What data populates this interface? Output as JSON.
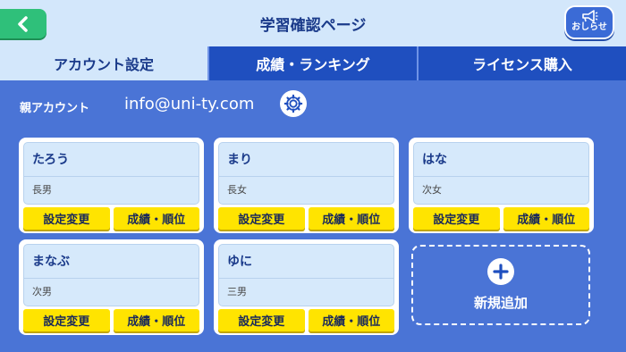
{
  "header": {
    "title": "学習確認ページ",
    "back_icon": "chevron-left-icon",
    "notice_label": "おしらせ",
    "notice_icon": "megaphone-icon"
  },
  "tabs": [
    {
      "label": "アカウント設定",
      "active": true
    },
    {
      "label": "成績・ランキング",
      "active": false
    },
    {
      "label": "ライセンス購入",
      "active": false
    }
  ],
  "account": {
    "label": "親アカウント",
    "email": "info@uni-ty.com",
    "settings_icon": "gear-icon"
  },
  "children": [
    {
      "name": "たろう",
      "relation": "長男",
      "settings_label": "設定変更",
      "results_label": "成績・順位"
    },
    {
      "name": "まり",
      "relation": "長女",
      "settings_label": "設定変更",
      "results_label": "成績・順位"
    },
    {
      "name": "はな",
      "relation": "次女",
      "settings_label": "設定変更",
      "results_label": "成績・順位"
    },
    {
      "name": "まなぶ",
      "relation": "次男",
      "settings_label": "設定変更",
      "results_label": "成績・順位"
    },
    {
      "name": "ゆに",
      "relation": "三男",
      "settings_label": "設定変更",
      "results_label": "成績・順位"
    }
  ],
  "add_child": {
    "label": "新規追加",
    "icon": "plus-icon"
  },
  "colors": {
    "background": "#4a74d6",
    "header": "#d3e7fb",
    "back_button": "#2fc07a",
    "action_button": "#ffe400",
    "tab_inactive": "#1f4fbf"
  }
}
